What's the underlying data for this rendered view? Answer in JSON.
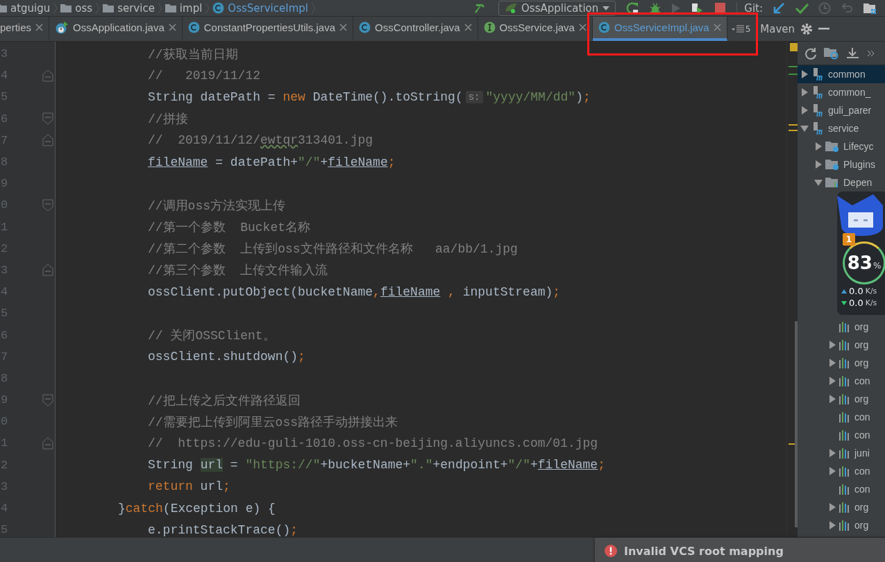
{
  "breadcrumbs": [
    {
      "label": "atguigu",
      "kind": "folder"
    },
    {
      "label": "oss",
      "kind": "folder"
    },
    {
      "label": "service",
      "kind": "folder"
    },
    {
      "label": "impl",
      "kind": "folder"
    },
    {
      "label": "OssServiceImpl",
      "kind": "class"
    }
  ],
  "toolbar": {
    "run_config": "OssApplication",
    "git_label": "Git:",
    "run_disabled": true
  },
  "tabs": [
    {
      "label": "perties",
      "kind": "plain",
      "selected": false
    },
    {
      "label": "OssApplication.java",
      "kind": "spring",
      "selected": false
    },
    {
      "label": "ConstantPropertiesUtils.java",
      "kind": "class",
      "selected": false
    },
    {
      "label": "OssController.java",
      "kind": "class",
      "selected": false
    },
    {
      "label": "OssService.java",
      "kind": "interface",
      "selected": false
    },
    {
      "label": "OssServiceImpl.java",
      "kind": "class",
      "selected": true
    }
  ],
  "tab_overflow": "5",
  "tool_window": {
    "title": "Maven"
  },
  "code": [
    {
      "number": "3",
      "kind": "code",
      "fold_start": false,
      "fold_end": false,
      "tokens": [
        {
          "kind": "comment",
          "text": "//获取当前日期"
        }
      ]
    },
    {
      "number": "4",
      "kind": "code",
      "fold_start": true,
      "fold_end": false,
      "tokens": [
        {
          "kind": "comment",
          "text": "//   2019/11/12"
        }
      ]
    },
    {
      "number": "5",
      "kind": "code",
      "fold_start": false,
      "fold_end": false,
      "tokens": [
        {
          "kind": "plain",
          "text": "String datePath = "
        },
        {
          "kind": "keyword",
          "text": "new"
        },
        {
          "kind": "plain",
          "text": " DateTime().toString("
        },
        {
          "kind": "hint",
          "text": "s:"
        },
        {
          "kind": "string",
          "text": "\"yyyy/MM/dd\""
        },
        {
          "kind": "plain",
          "text": ")"
        },
        {
          "kind": "keyword",
          "text": ";"
        }
      ]
    },
    {
      "number": "6",
      "kind": "code",
      "fold_start": false,
      "fold_end": true,
      "tokens": [
        {
          "kind": "comment",
          "text": "//拼接"
        }
      ]
    },
    {
      "number": "7",
      "kind": "code",
      "fold_start": true,
      "fold_end": false,
      "tokens": [
        {
          "kind": "comment",
          "text": "//  2019/11/12/"
        },
        {
          "kind": "typo",
          "text": "ewtqr"
        },
        {
          "kind": "comment",
          "text": "313401.jpg"
        }
      ]
    },
    {
      "number": "8",
      "kind": "code",
      "fold_start": false,
      "fold_end": false,
      "tokens": [
        {
          "kind": "underlined",
          "text": "fileName"
        },
        {
          "kind": "plain",
          "text": " = datePath+"
        },
        {
          "kind": "string",
          "text": "\"/\""
        },
        {
          "kind": "plain",
          "text": "+"
        },
        {
          "kind": "underlined",
          "text": "fileName"
        },
        {
          "kind": "keyword",
          "text": ";"
        }
      ]
    },
    {
      "number": "9",
      "kind": "code",
      "fold_start": false,
      "fold_end": false
    },
    {
      "number": "0",
      "kind": "code",
      "fold_start": false,
      "fold_end": true,
      "tokens": [
        {
          "kind": "comment",
          "text": "//调用oss方法实现上传"
        }
      ]
    },
    {
      "number": "1",
      "kind": "code",
      "fold_start": false,
      "fold_end": false,
      "tokens": [
        {
          "kind": "comment",
          "text": "//第一个参数  Bucket名称"
        }
      ]
    },
    {
      "number": "2",
      "kind": "code",
      "fold_start": false,
      "fold_end": false,
      "tokens": [
        {
          "kind": "comment",
          "text": "//第二个参数  上传到oss文件路径和文件名称   aa/bb/1.jpg"
        }
      ]
    },
    {
      "number": "3",
      "kind": "code",
      "fold_start": true,
      "fold_end": false,
      "tokens": [
        {
          "kind": "comment",
          "text": "//第三个参数  上传文件输入流"
        }
      ]
    },
    {
      "number": "4",
      "kind": "code",
      "fold_start": false,
      "fold_end": false,
      "tokens": [
        {
          "kind": "plain",
          "text": "ossClient.putObject(bucketName"
        },
        {
          "kind": "keyword",
          "text": ","
        },
        {
          "kind": "underlined",
          "text": "fileName"
        },
        {
          "kind": "keyword",
          "text": " ,"
        },
        {
          "kind": "plain",
          "text": " inputStream)"
        },
        {
          "kind": "keyword",
          "text": ";"
        }
      ]
    },
    {
      "number": "5",
      "kind": "code",
      "fold_start": false,
      "fold_end": false
    },
    {
      "number": "6",
      "kind": "code",
      "fold_start": false,
      "fold_end": false,
      "tokens": [
        {
          "kind": "comment",
          "text": "// 关闭OSSClient。"
        }
      ]
    },
    {
      "number": "7",
      "kind": "code",
      "fold_start": false,
      "fold_end": false,
      "tokens": [
        {
          "kind": "plain",
          "text": "ossClient.shutdown()"
        },
        {
          "kind": "keyword",
          "text": ";"
        }
      ]
    },
    {
      "number": "8",
      "kind": "code",
      "fold_start": false,
      "fold_end": false
    },
    {
      "number": "9",
      "kind": "code",
      "fold_start": false,
      "fold_end": true,
      "tokens": [
        {
          "kind": "comment",
          "text": "//把上传之后文件路径返回"
        }
      ]
    },
    {
      "number": "0",
      "kind": "code",
      "fold_start": false,
      "fold_end": false,
      "tokens": [
        {
          "kind": "comment",
          "text": "//需要把上传到阿里云oss路径手动拼接出来"
        }
      ]
    },
    {
      "number": "1",
      "kind": "code",
      "fold_start": true,
      "fold_end": false,
      "tokens": [
        {
          "kind": "comment",
          "text": "//  https://edu-guli-1010.oss-cn-beijing.aliyuncs.com/01.jpg"
        }
      ]
    },
    {
      "number": "2",
      "kind": "code",
      "fold_start": false,
      "fold_end": false,
      "tokens": [
        {
          "kind": "plain",
          "text": "String "
        },
        {
          "kind": "highlight",
          "text": "url"
        },
        {
          "kind": "plain",
          "text": " = "
        },
        {
          "kind": "string",
          "text": "\"https://\""
        },
        {
          "kind": "plain",
          "text": "+bucketName+"
        },
        {
          "kind": "string",
          "text": "\".\""
        },
        {
          "kind": "plain",
          "text": "+endpoint+"
        },
        {
          "kind": "string",
          "text": "\"/\""
        },
        {
          "kind": "plain",
          "text": "+"
        },
        {
          "kind": "underlined",
          "text": "fileName"
        },
        {
          "kind": "keyword",
          "text": ";"
        }
      ]
    },
    {
      "number": "3",
      "kind": "code",
      "fold_start": false,
      "fold_end": false,
      "tokens": [
        {
          "kind": "keyword",
          "text": "return"
        },
        {
          "kind": "plain",
          "text": " url"
        },
        {
          "kind": "keyword",
          "text": ";"
        }
      ]
    },
    {
      "number": "4",
      "kind": "closing",
      "fold_start": false,
      "fold_end": false,
      "tokens": [
        {
          "kind": "plain",
          "text": "}"
        },
        {
          "kind": "keyword",
          "text": "catch"
        },
        {
          "kind": "plain",
          "text": "(Exception e) {"
        }
      ]
    },
    {
      "number": "5",
      "kind": "code",
      "fold_start": false,
      "fold_end": false,
      "tokens": [
        {
          "kind": "plain",
          "text": "e.printStackTrace()"
        },
        {
          "kind": "keyword",
          "text": ";"
        }
      ]
    }
  ],
  "maven_tree": [
    {
      "label": "common",
      "kind": "module",
      "expanded": false,
      "selected": true
    },
    {
      "label": "common_",
      "kind": "module",
      "expanded": false,
      "selected": false
    },
    {
      "label": "guli_parer",
      "kind": "module",
      "expanded": false,
      "selected": false
    },
    {
      "label": "service",
      "kind": "module",
      "expanded": true,
      "selected": false,
      "children": [
        {
          "label": "Lifecyc",
          "kind": "settings-folder",
          "expanded": false,
          "selected": false
        },
        {
          "label": "Plugins",
          "kind": "settings-folder",
          "expanded": false,
          "selected": false
        },
        {
          "label": "Depen",
          "kind": "deps-folder",
          "expanded": true,
          "selected": false,
          "children": [
            {
              "label": "org",
              "kind": "library",
              "expandable": false
            },
            {
              "label": "org",
              "kind": "library",
              "expandable": true
            },
            {
              "label": "org",
              "kind": "library",
              "expandable": true
            },
            {
              "label": "con",
              "kind": "library",
              "expandable": true
            },
            {
              "label": "org",
              "kind": "library",
              "expandable": true
            },
            {
              "label": "con",
              "kind": "library",
              "expandable": false
            },
            {
              "label": "con",
              "kind": "library",
              "expandable": false
            },
            {
              "label": "juni",
              "kind": "library",
              "expandable": true
            },
            {
              "label": "con",
              "kind": "library",
              "expandable": true
            },
            {
              "label": "con",
              "kind": "library",
              "expandable": false
            },
            {
              "label": "org",
              "kind": "library",
              "expandable": true
            },
            {
              "label": "org",
              "kind": "library",
              "expandable": true
            }
          ]
        }
      ]
    }
  ],
  "speed_widget": {
    "badge": "1",
    "percent": "83",
    "percent_unit": "%",
    "upload": "0.0",
    "upload_unit": "K/s",
    "download": "0.0",
    "download_unit": "K/s"
  },
  "notification": {
    "kind": "error",
    "text": "Invalid VCS root mapping"
  },
  "annotation": {
    "kind": "rectangle",
    "color": "#ff1a1a"
  }
}
